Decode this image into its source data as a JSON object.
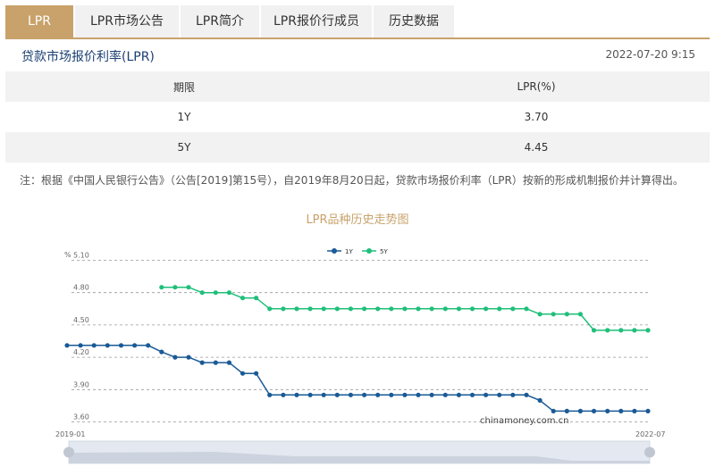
{
  "tabs": [
    {
      "label": "LPR",
      "active": true
    },
    {
      "label": "LPR市场公告",
      "active": false
    },
    {
      "label": "LPR简介",
      "active": false
    },
    {
      "label": "LPR报价行成员",
      "active": false
    },
    {
      "label": "历史数据",
      "active": false
    }
  ],
  "header": {
    "title": "贷款市场报价利率(LPR)",
    "timestamp": "2022-07-20 9:15"
  },
  "table": {
    "headers": [
      "期限",
      "LPR(%)"
    ],
    "rows": [
      {
        "term": "1Y",
        "rate": "3.70"
      },
      {
        "term": "5Y",
        "rate": "4.45"
      }
    ]
  },
  "note": "注：根据《中国人民银行公告》（公告[2019]第15号），自2019年8月20日起，贷款市场报价利率（LPR）按新的形成机制报价并计算得出。",
  "colors": {
    "accent": "#c8a26a",
    "series_1y": "#1a5a96",
    "series_5y": "#1fbf7a"
  },
  "chart_data": {
    "type": "line",
    "title": "LPR品种历史走势图",
    "ylabel": "%",
    "ylim": [
      3.6,
      5.1
    ],
    "yticks": [
      "5.10",
      "4.80",
      "4.50",
      "4.20",
      "3.90",
      "3.60"
    ],
    "x_start_label": "2019-01",
    "x_end_label": "2022-07",
    "legend_position": "top",
    "watermark": "chinamoney.com.cn",
    "grid": true,
    "series": [
      {
        "name": "1Y",
        "values": [
          4.31,
          4.31,
          4.31,
          4.31,
          4.31,
          4.31,
          4.31,
          4.25,
          4.2,
          4.2,
          4.15,
          4.15,
          4.15,
          4.05,
          4.05,
          3.85,
          3.85,
          3.85,
          3.85,
          3.85,
          3.85,
          3.85,
          3.85,
          3.85,
          3.85,
          3.85,
          3.85,
          3.85,
          3.85,
          3.85,
          3.85,
          3.85,
          3.85,
          3.85,
          3.85,
          3.8,
          3.7,
          3.7,
          3.7,
          3.7,
          3.7,
          3.7,
          3.7,
          3.7
        ]
      },
      {
        "name": "5Y",
        "values": [
          null,
          null,
          null,
          null,
          null,
          null,
          null,
          4.85,
          4.85,
          4.85,
          4.8,
          4.8,
          4.8,
          4.75,
          4.75,
          4.65,
          4.65,
          4.65,
          4.65,
          4.65,
          4.65,
          4.65,
          4.65,
          4.65,
          4.65,
          4.65,
          4.65,
          4.65,
          4.65,
          4.65,
          4.65,
          4.65,
          4.65,
          4.65,
          4.65,
          4.6,
          4.6,
          4.6,
          4.6,
          4.45,
          4.45,
          4.45,
          4.45,
          4.45
        ]
      }
    ]
  }
}
